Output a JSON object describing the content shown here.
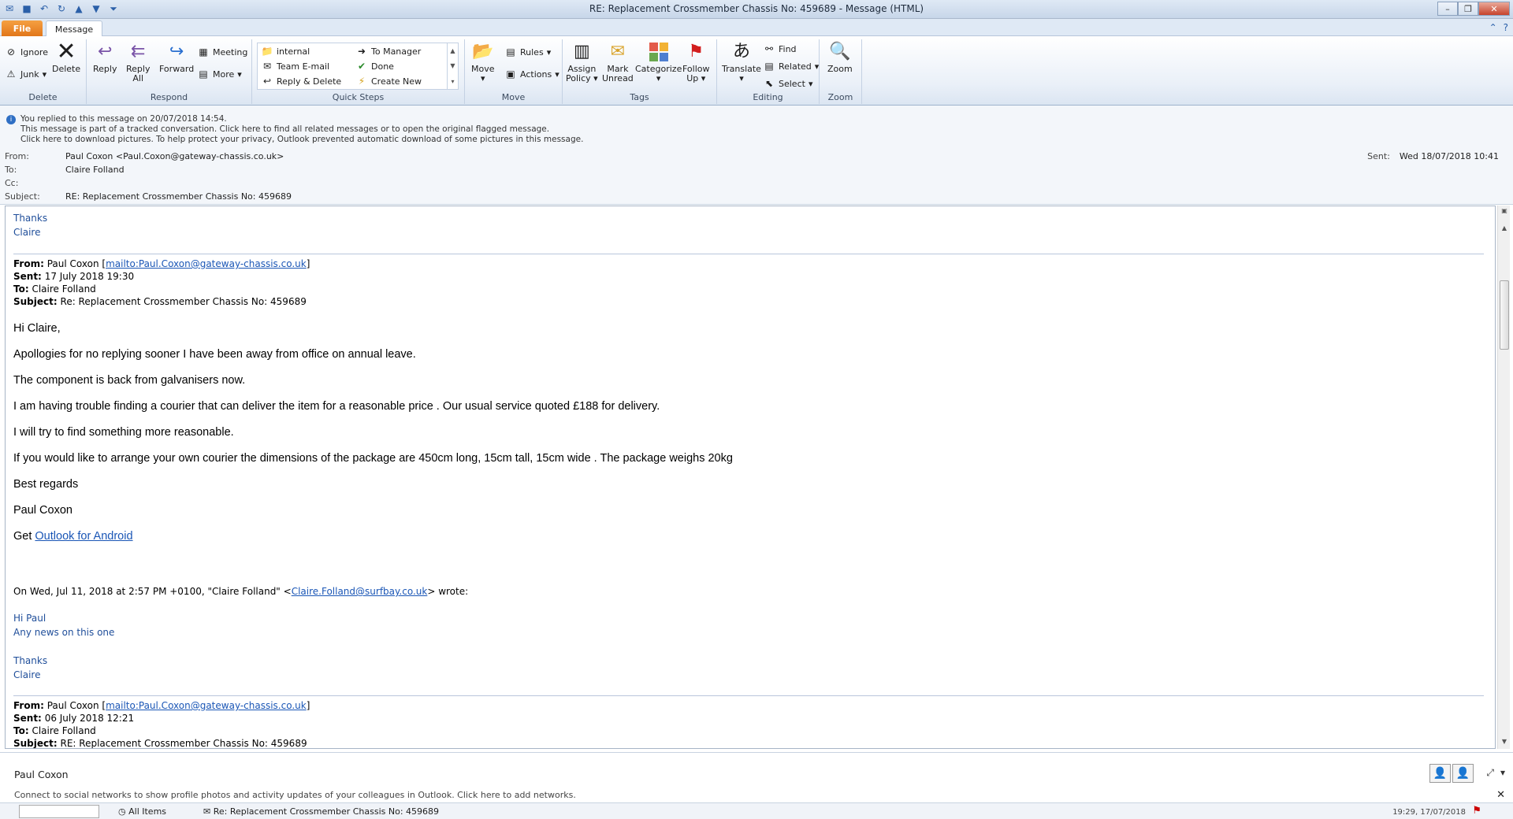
{
  "window": {
    "title": "RE: Replacement Crossmember Chassis No: 459689  -  Message (HTML)"
  },
  "tabs": {
    "file": "File",
    "message": "Message"
  },
  "ribbon": {
    "delete_group": {
      "label": "Delete",
      "ignore": "Ignore",
      "junk": "Junk",
      "delete": "Delete"
    },
    "respond_group": {
      "label": "Respond",
      "reply": "Reply",
      "reply_all_1": "Reply",
      "reply_all_2": "All",
      "forward": "Forward",
      "meeting": "Meeting",
      "more": "More"
    },
    "quicksteps_group": {
      "label": "Quick Steps",
      "items": [
        "internal",
        "Team E-mail",
        "Reply & Delete",
        "To Manager",
        "Done",
        "Create New"
      ]
    },
    "move_group": {
      "label": "Move",
      "move": "Move",
      "rules": "Rules",
      "actions": "Actions"
    },
    "tags_group": {
      "label": "Tags",
      "assign_1": "Assign",
      "assign_2": "Policy",
      "mark_1": "Mark",
      "mark_2": "Unread",
      "categorize": "Categorize",
      "follow_1": "Follow",
      "follow_2": "Up"
    },
    "editing_group": {
      "label": "Editing",
      "translate": "Translate",
      "find": "Find",
      "related": "Related",
      "select": "Select"
    },
    "zoom_group": {
      "label": "Zoom",
      "zoom": "Zoom"
    }
  },
  "infobar": {
    "line1": "You replied to this message on 20/07/2018 14:54.",
    "line2": "This message is part of a tracked conversation. Click here to find all related messages or to open the original flagged message.",
    "line3": "Click here to download pictures. To help protect your privacy, Outlook prevented automatic download of some pictures in this message."
  },
  "headers": {
    "from_label": "From:",
    "from_value": "Paul Coxon <Paul.Coxon@gateway-chassis.co.uk>",
    "to_label": "To:",
    "to_value": "Claire Folland",
    "cc_label": "Cc:",
    "subject_label": "Subject:",
    "subject_value": "RE: Replacement Crossmember Chassis No: 459689",
    "sent_label": "Sent:",
    "sent_value": "Wed 18/07/2018 10:41"
  },
  "body": {
    "top_thanks": "Thanks",
    "top_claire": "Claire",
    "q1": {
      "from_label": "From:",
      "from_name": "Paul Coxon [",
      "from_link": "mailto:Paul.Coxon@gateway-chassis.co.uk",
      "from_end": "]",
      "sent_label": "Sent:",
      "sent_value": "17 July 2018 19:30",
      "to_label": "To:",
      "to_value": "Claire Folland",
      "subject_label": "Subject:",
      "subject_value": "Re: Replacement Crossmember Chassis No: 459689"
    },
    "paragraphs": [
      "Hi Claire,",
      "Apollogies for no replying sooner I have been away from office on annual leave.",
      "The component is back from galvanisers now.",
      "I am having trouble finding a courier that can deliver the item for a reasonable price . Our usual service quoted £188 for delivery.",
      "I will try to find something more reasonable.",
      "If you would like to arrange your own courier the dimensions of the package are 450cm long, 15cm tall, 15cm wide . The package weighs 20kg",
      "Best regards",
      "Paul Coxon"
    ],
    "get_prefix": "Get ",
    "get_link": "Outlook for Android",
    "wrote_prefix": "On Wed, Jul 11, 2018 at 2:57 PM +0100, \"Claire Folland\" <",
    "wrote_link": "Claire.Folland@surfbay.co.uk",
    "wrote_suffix": "> wrote:",
    "hi_paul": "Hi Paul",
    "any_news": "Any news on this one",
    "thanks2": "Thanks",
    "claire2": "Claire",
    "q2": {
      "from_label": "From:",
      "from_name": "Paul Coxon [",
      "from_link": "mailto:Paul.Coxon@gateway-chassis.co.uk",
      "from_end": "]",
      "sent_label": "Sent:",
      "sent_value": "06 July 2018 12:21",
      "to_label": "To:",
      "to_value": "Claire Folland",
      "subject_label": "Subject:",
      "subject_value": "RE: Replacement Crossmember Chassis No: 459689"
    }
  },
  "people_pane": {
    "name": "Paul Coxon",
    "connect": "Connect to social networks to show profile photos and activity updates of your colleagues in Outlook. Click here to add networks."
  },
  "status_strip": {
    "all_items": "All Items",
    "subject": "Re: Replacement Crossmember Chassis No: 459689",
    "time": "19:29, 17/07/2018"
  }
}
